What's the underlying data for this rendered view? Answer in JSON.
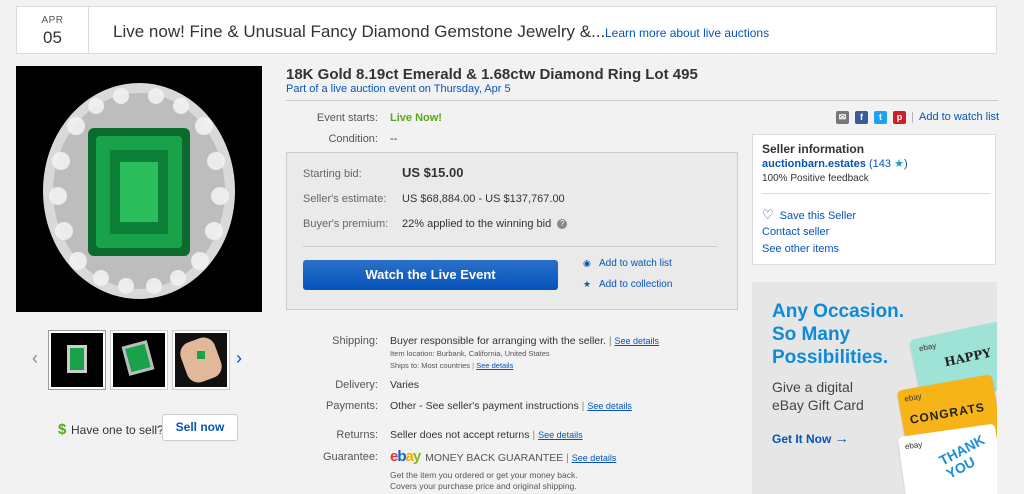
{
  "banner": {
    "month": "APR",
    "day": "05",
    "title": "Live now!  Fine & Unusual Fancy Diamond Gemstone Jewelry &...",
    "learn_more": "Learn more about live auctions"
  },
  "item": {
    "title": "18K Gold 8.19ct Emerald & 1.68ctw Diamond Ring Lot 495",
    "subtitle": "Part of a live auction event on Thursday, Apr 5"
  },
  "event": {
    "starts_label": "Event starts:",
    "starts_value": "Live Now!",
    "condition_label": "Condition:",
    "condition_value": "--"
  },
  "bid": {
    "starting_label": "Starting bid:",
    "starting_value": "US $15.00",
    "estimate_label": "Seller's estimate:",
    "estimate_value": "US $68,884.00 - US $137,767.00",
    "premium_label": "Buyer's premium:",
    "premium_value": "22% applied to the winning bid",
    "watch_button": "Watch the Live Event",
    "add_watch": "Add to watch list",
    "add_collection": "Add to collection"
  },
  "share": {
    "add_watch": "Add to watch list"
  },
  "seller": {
    "heading": "Seller information",
    "name": "auctionbarn.estates",
    "count": "(143",
    "feedback": "100% Positive feedback",
    "save": "Save this Seller",
    "contact": "Contact seller",
    "other": "See other items"
  },
  "ad": {
    "headline_1": "Any Occasion.",
    "headline_2": "So Many",
    "headline_3": "Possibilities.",
    "sub_1": "Give a digital",
    "sub_2": "eBay Gift Card",
    "cta": "Get It Now",
    "card_1": "HAPPY",
    "card_2": "CONGRATS",
    "card_3": "THANK YOU"
  },
  "sell": {
    "label": "Have one to sell?",
    "button": "Sell now"
  },
  "details": {
    "shipping_label": "Shipping:",
    "shipping_value": "Buyer responsible for arranging with the seller.",
    "item_location": "Item location:  Burbank, California, United States",
    "ships_to": "Ships to:  Most countries",
    "delivery_label": "Delivery:",
    "delivery_value": "Varies",
    "payments_label": "Payments:",
    "payments_value": "Other - See seller's payment instructions",
    "returns_label": "Returns:",
    "returns_value": "Seller does not accept returns",
    "guarantee_label": "Guarantee:",
    "guarantee_value": "MONEY BACK GUARANTEE",
    "guarantee_line1": "Get the item you ordered or get your money back.",
    "guarantee_line2": "Covers your purchase price and original shipping.",
    "see_details": "See details"
  },
  "colors": {
    "accent": "#0654ba",
    "live": "#5ba71b",
    "ad_headline": "#0d8bd9"
  }
}
